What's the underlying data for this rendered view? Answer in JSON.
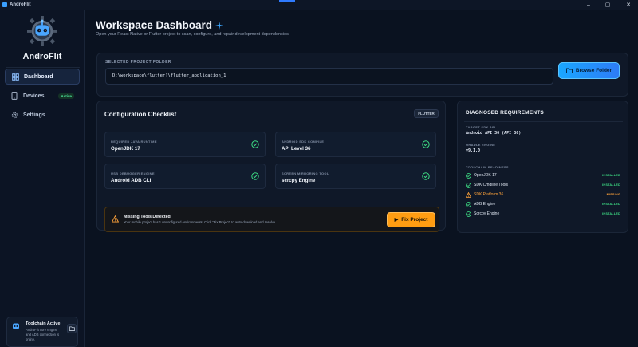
{
  "window": {
    "title": "AndroFlit",
    "minimize": "–",
    "maximize": "▢",
    "close": "✕"
  },
  "sidebar": {
    "brand": "AndroFlit",
    "items": [
      {
        "label": "Dashboard",
        "icon": "dashboard-icon",
        "active": true
      },
      {
        "label": "Devices",
        "icon": "devices-icon",
        "badge": "Active"
      },
      {
        "label": "Settings",
        "icon": "gear-icon"
      }
    ],
    "toolchain": {
      "title": "Toolchain Active",
      "description": "AndroFlit core engine and ADB connection is online."
    }
  },
  "header": {
    "title": "Workspace Dashboard",
    "subtitle": "Open your React Native or Flutter project to scan, configure, and repair development dependencies."
  },
  "folder": {
    "label": "SELECTED PROJECT FOLDER",
    "path": "D:\\workspace\\flutter]\\flutter_application_1",
    "browse_label": "Browse Folder"
  },
  "checklist": {
    "title": "Configuration Checklist",
    "badge": "FLUTTER",
    "items": [
      {
        "label": "REQUIRED JAVA RUNTIME",
        "value": "OpenJDK 17"
      },
      {
        "label": "ANDROID SDK COMPILE",
        "value": "API Level 36"
      },
      {
        "label": "USB DEBUGGER ENGINE",
        "value": "Android ADB CLI"
      },
      {
        "label": "SCREEN MIRRORING TOOL",
        "value": "scrcpy Engine"
      }
    ],
    "warning": {
      "title": "Missing Tools Detected",
      "description": "Your mobile project has 1 unconfigured environments. Click \"Fix Project\" to auto-download and resolve.",
      "fix_label": "Fix Project"
    }
  },
  "diagnosed": {
    "title": "DIAGNOSED REQUIREMENTS",
    "target_sdk_label": "TARGET SDK API",
    "target_sdk_value": "Android API 36 (API 36)",
    "gradle_label": "GRADLE ENGINE",
    "gradle_value": "v9.1.0",
    "readiness_label": "TOOLCHAIN READINESS",
    "tools": [
      {
        "name": "OpenJDK 17",
        "status": "INSTALLED",
        "state": "ok"
      },
      {
        "name": "SDK Cmdline Tools",
        "status": "INSTALLED",
        "state": "ok"
      },
      {
        "name": "SDK Platform 36",
        "status": "MISSING",
        "state": "missing"
      },
      {
        "name": "ADB Engine",
        "status": "INSTALLED",
        "state": "ok"
      },
      {
        "name": "Scrcpy Engine",
        "status": "INSTALLED",
        "state": "ok"
      }
    ]
  },
  "colors": {
    "accent_blue": "#2d7cf6",
    "ok_green": "#3ddc84",
    "warn_orange": "#ffa33a",
    "background": "#0a1220"
  }
}
